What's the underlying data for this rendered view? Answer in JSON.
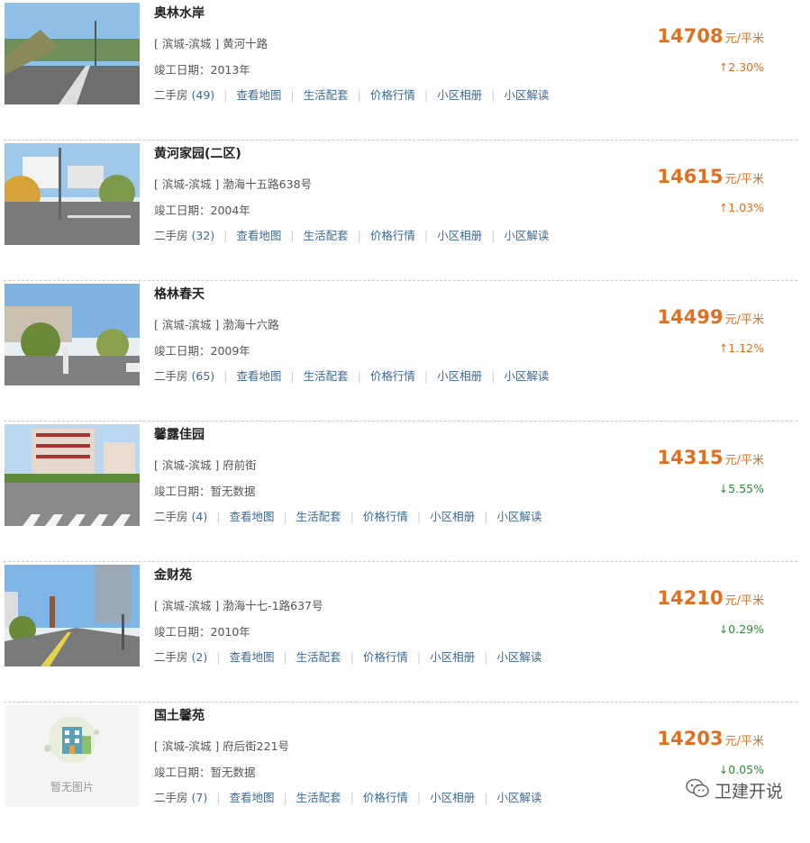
{
  "listings": [
    {
      "name": "奥林水岸",
      "address": "[ 滨城-滨城 ] 黄河十路",
      "built": "竣工日期：2013年",
      "price": "14708",
      "unit": "元/平米",
      "change": "↑2.30%",
      "change_dir": "up",
      "secondhand_label": "二手房",
      "secondhand_count": "(49)",
      "photo": "road"
    },
    {
      "name": "黄河家园(二区)",
      "address": "[ 滨城-滨城 ] 渤海十五路638号",
      "built": "竣工日期：2004年",
      "price": "14615",
      "unit": "元/平米",
      "change": "↑1.03%",
      "change_dir": "up",
      "secondhand_label": "二手房",
      "secondhand_count": "(32)",
      "photo": "trees"
    },
    {
      "name": "格林春天",
      "address": "[ 滨城-滨城 ] 渤海十六路",
      "built": "竣工日期：2009年",
      "price": "14499",
      "unit": "元/平米",
      "change": "↑1.12%",
      "change_dir": "up",
      "secondhand_label": "二手房",
      "secondhand_count": "(65)",
      "photo": "street"
    },
    {
      "name": "馨露佳园",
      "address": "[ 滨城-滨城 ] 府前街",
      "built": "竣工日期：暂无数据",
      "price": "14315",
      "unit": "元/平米",
      "change": "↓5.55%",
      "change_dir": "down",
      "secondhand_label": "二手房",
      "secondhand_count": "(4)",
      "photo": "crosswalk"
    },
    {
      "name": "金财苑",
      "address": "[ 滨城-滨城 ] 渤海十七-1路637号",
      "built": "竣工日期：2010年",
      "price": "14210",
      "unit": "元/平米",
      "change": "↓0.29%",
      "change_dir": "down",
      "secondhand_label": "二手房",
      "secondhand_count": "(2)",
      "photo": "towers"
    },
    {
      "name": "国土馨苑",
      "address": "[ 滨城-滨城 ] 府后街221号",
      "built": "竣工日期：暂无数据",
      "price": "14203",
      "unit": "元/平米",
      "change": "↓0.05%",
      "change_dir": "down",
      "secondhand_label": "二手房",
      "secondhand_count": "(7)",
      "photo": "none",
      "no_image_text": "暂无图片"
    }
  ],
  "links": {
    "map": "查看地图",
    "life": "生活配套",
    "price": "价格行情",
    "album": "小区相册",
    "analysis": "小区解读"
  },
  "watermark": {
    "text": "卫建开说"
  },
  "colors": {
    "price": "#e07020",
    "up": "#e07020",
    "down": "#2e8b3a",
    "link": "#3a6a9a"
  }
}
